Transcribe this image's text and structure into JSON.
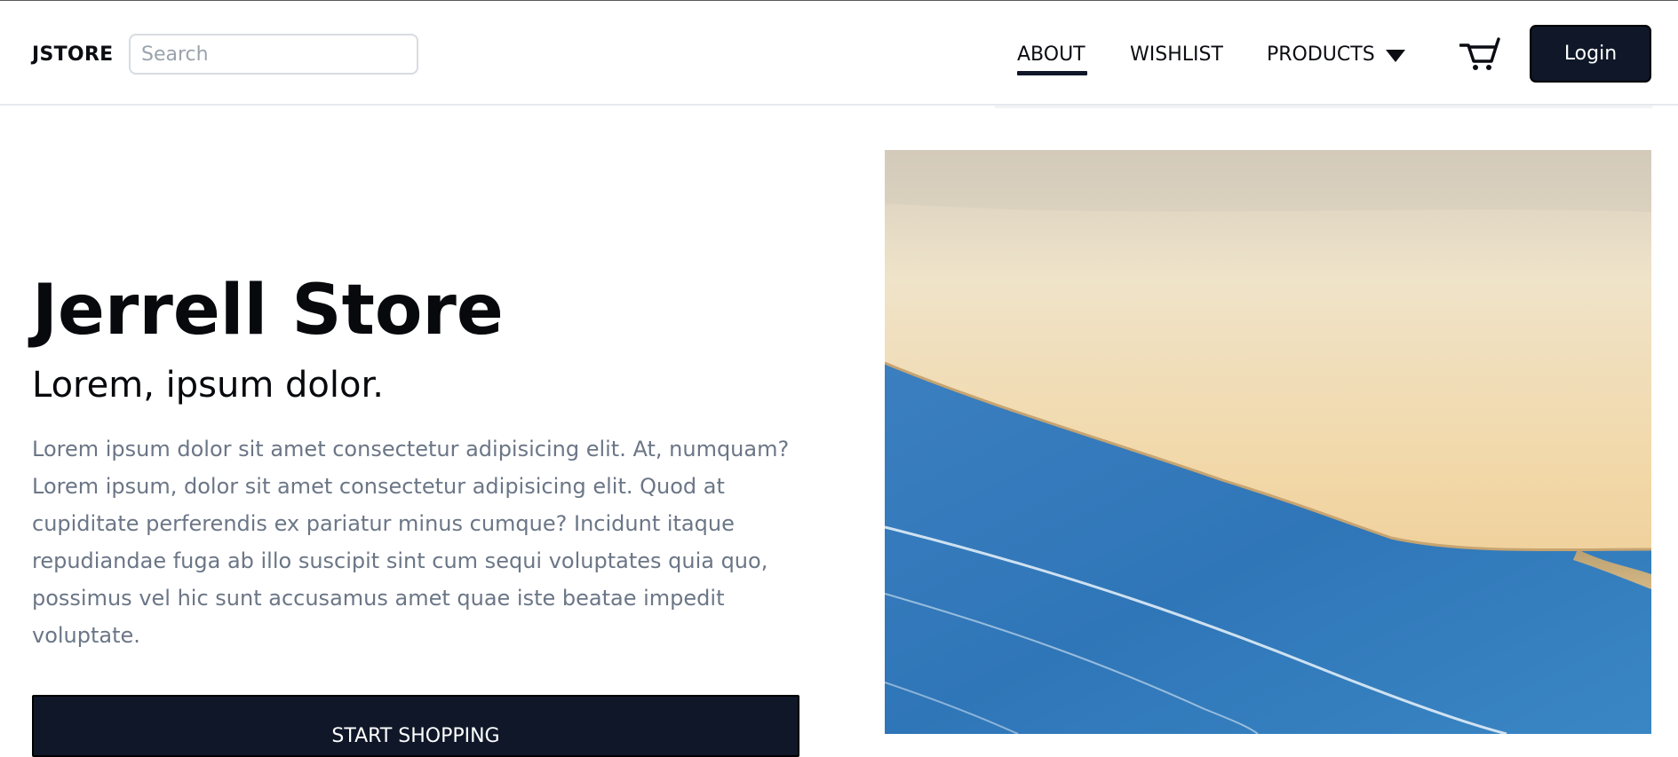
{
  "header": {
    "brand": "JSTORE",
    "search": {
      "placeholder": "Search",
      "value": ""
    },
    "nav": [
      {
        "label": "ABOUT",
        "active": true
      },
      {
        "label": "WISHLIST",
        "active": false
      },
      {
        "label": "PRODUCTS",
        "active": false
      }
    ],
    "login_label": "Login"
  },
  "hero": {
    "title": "Jerrell Store",
    "subtitle": "Lorem, ipsum dolor.",
    "body": "Lorem ipsum dolor sit amet consectetur adipisicing elit. At, numquam? Lorem ipsum, dolor sit amet consectetur adipisicing elit. Quod at cupiditate perferendis ex pariatur minus cumque? Incidunt itaque repudiandae fuga ab illo suscipit sint cum sequi voluptates quia quo, possimus vel hic sunt accusamus amet quae iste beatae impedit voluptate.",
    "cta_label": "START SHOPPING",
    "image": "beach-aerial-image"
  },
  "icons": {
    "cart": "cart-icon",
    "products_dropdown": "chevron-down-icon"
  },
  "colors": {
    "primary": "#0f1729",
    "body_text": "#6b7686",
    "heading": "#07090d",
    "border": "#d7dbe1"
  }
}
